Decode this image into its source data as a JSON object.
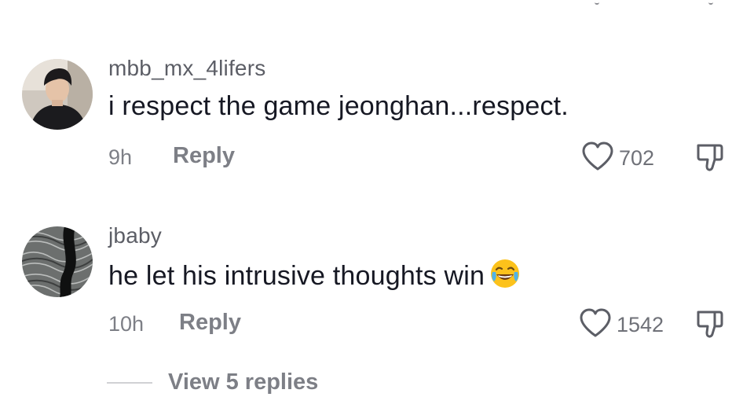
{
  "comments": [
    {
      "username": "mbb_mx_4lifers",
      "text": "i respect the game jeonghan...respect.",
      "time": "9h",
      "reply_label": "Reply",
      "like_count": "702"
    },
    {
      "username": "jbaby",
      "text": "he let his intrusive thoughts win",
      "emoji": "face-with-tears-of-joy",
      "time": "10h",
      "reply_label": "Reply",
      "like_count": "1542"
    }
  ],
  "view_replies_label": "View 5 replies",
  "icons": {
    "like": "heart-outline-icon",
    "dislike": "thumbs-down-outline-icon"
  },
  "colors": {
    "text_primary": "#161823",
    "text_secondary": "#7d7f86",
    "username": "#5c5e66",
    "background": "#ffffff"
  }
}
